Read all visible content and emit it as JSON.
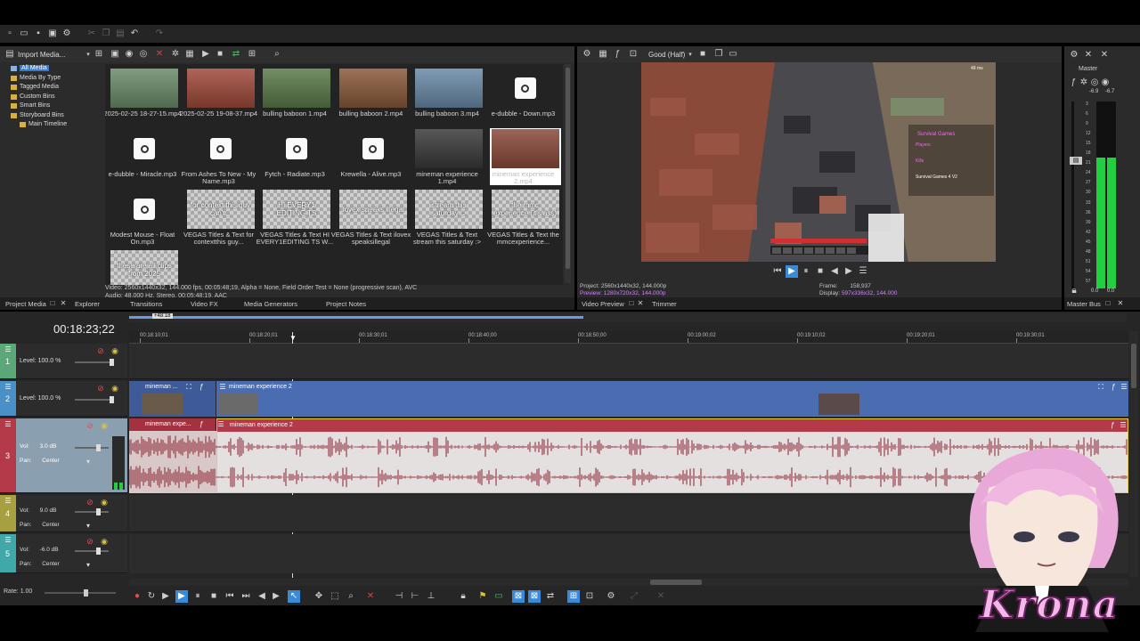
{
  "toolbar": {
    "icons": [
      "new-icon",
      "open-icon",
      "save-icon",
      "save-as-icon",
      "render-icon",
      "properties-icon",
      "cut-icon",
      "copy-icon",
      "paste-icon",
      "undo-icon",
      "redo-icon"
    ]
  },
  "media_toolbar": {
    "import_label": "Import Media..."
  },
  "tree": [
    {
      "label": "All Media",
      "selected": true
    },
    {
      "label": "Media By Type"
    },
    {
      "label": "Tagged Media"
    },
    {
      "label": "Custom Bins"
    },
    {
      "label": "Smart Bins"
    },
    {
      "label": "Storyboard Bins"
    },
    {
      "label": "Main Timeline"
    }
  ],
  "media": [
    {
      "label": "2025-02-25 18-27-15.mp4",
      "kind": "video",
      "c": "#6b8c6a"
    },
    {
      "label": "2025-02-25 19-08-37.mp4",
      "kind": "video",
      "c": "#a04a3a"
    },
    {
      "label": "bulling baboon 1.mp4",
      "kind": "video",
      "c": "#5b7a4a"
    },
    {
      "label": "bulling baboon 2.mp4",
      "kind": "video",
      "c": "#8a5a3a"
    },
    {
      "label": "bulling baboon 3.mp4",
      "kind": "video",
      "c": "#6a8aa8"
    },
    {
      "label": "e-dubble - Down.mp3",
      "kind": "audio"
    },
    {
      "label": "e-dubble - Miracle.mp3",
      "kind": "audio"
    },
    {
      "label": "From Ashes To New - My Name.mp3",
      "kind": "audio"
    },
    {
      "label": "Fytch - Radiate.mp3",
      "kind": "audio"
    },
    {
      "label": "Krewella - Alive.mp3",
      "kind": "audio"
    },
    {
      "label": "mineman experience 1.mp4",
      "kind": "video",
      "c": "#3a3a3a"
    },
    {
      "label": "mineman experience 2.mp4",
      "kind": "video",
      "c": "#8a4a3a",
      "selected": true
    },
    {
      "label": "Modest Mouse - Float On.mp3",
      "kind": "audio"
    },
    {
      "label": "VEGAS Titles & Text for contextthis guy...",
      "kind": "title",
      "text": "for context this guy can't..."
    },
    {
      "label": "VEGAS Titles & Text HI EVERY1EDITING TS W...",
      "kind": "title",
      "text": "HI EVERY1 EDITING TS"
    },
    {
      "label": "VEGAS Titles & Text ilovex speaksillegal",
      "kind": "title",
      "text": "ilovex speaks illegal"
    },
    {
      "label": "VEGAS Titles & Text stream this saturday :>",
      "kind": "title",
      "text": "stream this saturday :>"
    },
    {
      "label": "VEGAS Titles & Text the mmcexperience...",
      "kind": "title",
      "text": "the mmc experience (it's ass)"
    },
    {
      "label": "",
      "kind": "title",
      "text": "these are all clips from 2025"
    }
  ],
  "media_info": {
    "line1": "Video: 2560x1440x32, 144.000 fps, 00:05:48;19, Alpha = None, Field Order Test = None (progressive scan), AVC",
    "line2": "Audio: 48,000 Hz, Stereo, 00:05:48;19, AAC"
  },
  "left_tabs": [
    "Project Media",
    "Explorer",
    "Transitions",
    "Video FX",
    "Media Generators",
    "Project Notes"
  ],
  "preview": {
    "quality": "Good (Half)",
    "project": "Project:  2560x1440x32, 144.000p",
    "preview": "Preview:  1280x720x32, 144.000p",
    "frame_label": "Frame:",
    "frame_value": "158,937",
    "display_label": "Display:",
    "display_value": "597x336x32, 144.000",
    "tabs": [
      "Video Preview",
      "Trimmer"
    ],
    "hud": {
      "title": "Survival Games",
      "players": "Players",
      "kills": "Kills",
      "line": "Survival Games 4 V2",
      "fps": "49 ms"
    }
  },
  "master": {
    "title": "Master",
    "tab": "Master Bus",
    "peak_l": "-6.9",
    "peak_r": "-6.7",
    "scale": [
      "3",
      "6",
      "9",
      "12",
      "15",
      "18",
      "21",
      "24",
      "27",
      "30",
      "33",
      "36",
      "39",
      "42",
      "45",
      "48",
      "51",
      "54",
      "57"
    ],
    "bottom_l": "0.0",
    "bottom_r": "0.0",
    "level": 0.7
  },
  "timeline": {
    "timecode": "00:18:23;22",
    "loop_marker": "+48:18",
    "ruler": [
      "00:18:10;01",
      "00:18:20;01",
      "00:18:30;01",
      "00:18:40;00",
      "00:18:50;00",
      "00:19:00;02",
      "00:19:10;02",
      "00:19:20;01",
      "00:19:30;01"
    ],
    "tracks": [
      {
        "num": "1",
        "color": "#5aa878",
        "level_label": "Level:",
        "level": "100.0 %"
      },
      {
        "num": "2",
        "color": "#4a90c8",
        "level_label": "Level:",
        "level": "100.0 %"
      },
      {
        "num": "3",
        "color": "#c0405a",
        "vol_label": "Vol:",
        "vol": "3.0 dB",
        "pan_label": "Pan:",
        "pan": "Center"
      },
      {
        "num": "4",
        "color": "#a8a040",
        "vol_label": "Vol:",
        "vol": "9.0 dB",
        "pan_label": "Pan:",
        "pan": "Center"
      },
      {
        "num": "5",
        "color": "#40a8a8",
        "vol_label": "Vol:",
        "vol": "-6.0 dB",
        "pan_label": "Pan:",
        "pan": "Center"
      }
    ],
    "video_events": [
      "mineman ...",
      "mineman experience 2"
    ],
    "audio_events": [
      "mineman expe...",
      "mineman experience 2"
    ],
    "rate_label": "Rate:",
    "rate": "1.00"
  },
  "overlay": {
    "name": "Krona"
  },
  "colors": {
    "video_track": "#4a6cb0",
    "audio_track": "#b43a4a",
    "wave": "#8a2030",
    "panel": "#2b2b2b"
  }
}
